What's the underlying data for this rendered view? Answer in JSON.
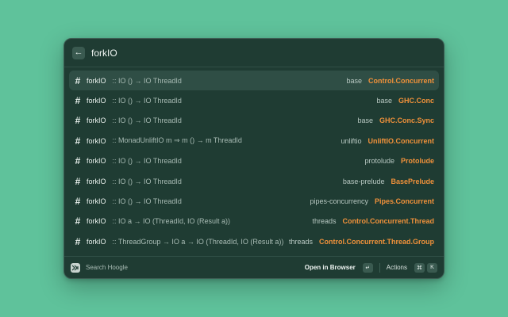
{
  "search": {
    "back_icon": "arrow-left-icon",
    "value": "forkIO"
  },
  "results": [
    {
      "name": "forkIO",
      "signature": ":: IO () → IO ThreadId",
      "package": "base",
      "module": "Control.Concurrent",
      "selected": true
    },
    {
      "name": "forkIO",
      "signature": ":: IO () → IO ThreadId",
      "package": "base",
      "module": "GHC.Conc",
      "selected": false
    },
    {
      "name": "forkIO",
      "signature": ":: IO () → IO ThreadId",
      "package": "base",
      "module": "GHC.Conc.Sync",
      "selected": false
    },
    {
      "name": "forkIO",
      "signature": ":: MonadUnliftIO m ⇒ m () → m ThreadId",
      "package": "unliftio",
      "module": "UnliftIO.Concurrent",
      "selected": false
    },
    {
      "name": "forkIO",
      "signature": ":: IO () → IO ThreadId",
      "package": "protolude",
      "module": "Protolude",
      "selected": false
    },
    {
      "name": "forkIO",
      "signature": ":: IO () → IO ThreadId",
      "package": "base-prelude",
      "module": "BasePrelude",
      "selected": false
    },
    {
      "name": "forkIO",
      "signature": ":: IO () → IO ThreadId",
      "package": "pipes-concurrency",
      "module": "Pipes.Concurrent",
      "selected": false
    },
    {
      "name": "forkIO",
      "signature": ":: IO a → IO (ThreadId, IO (Result a))",
      "package": "threads",
      "module": "Control.Concurrent.Thread",
      "selected": false
    },
    {
      "name": "forkIO",
      "signature": ":: ThreadGroup → IO a → IO (ThreadId, IO (Result a))",
      "package": "threads",
      "module": "Control.Concurrent.Thread.Group",
      "selected": false
    }
  ],
  "footer": {
    "title": "Search Hoogle",
    "primary_action": "Open in Browser",
    "primary_shortcut": "↵",
    "actions_label": "Actions",
    "actions_shortcut_mod": "⌘",
    "actions_shortcut_key": "K"
  },
  "colors": {
    "background": "#5fc29b",
    "window": "#1f3c33",
    "module_accent": "#f0913a"
  }
}
